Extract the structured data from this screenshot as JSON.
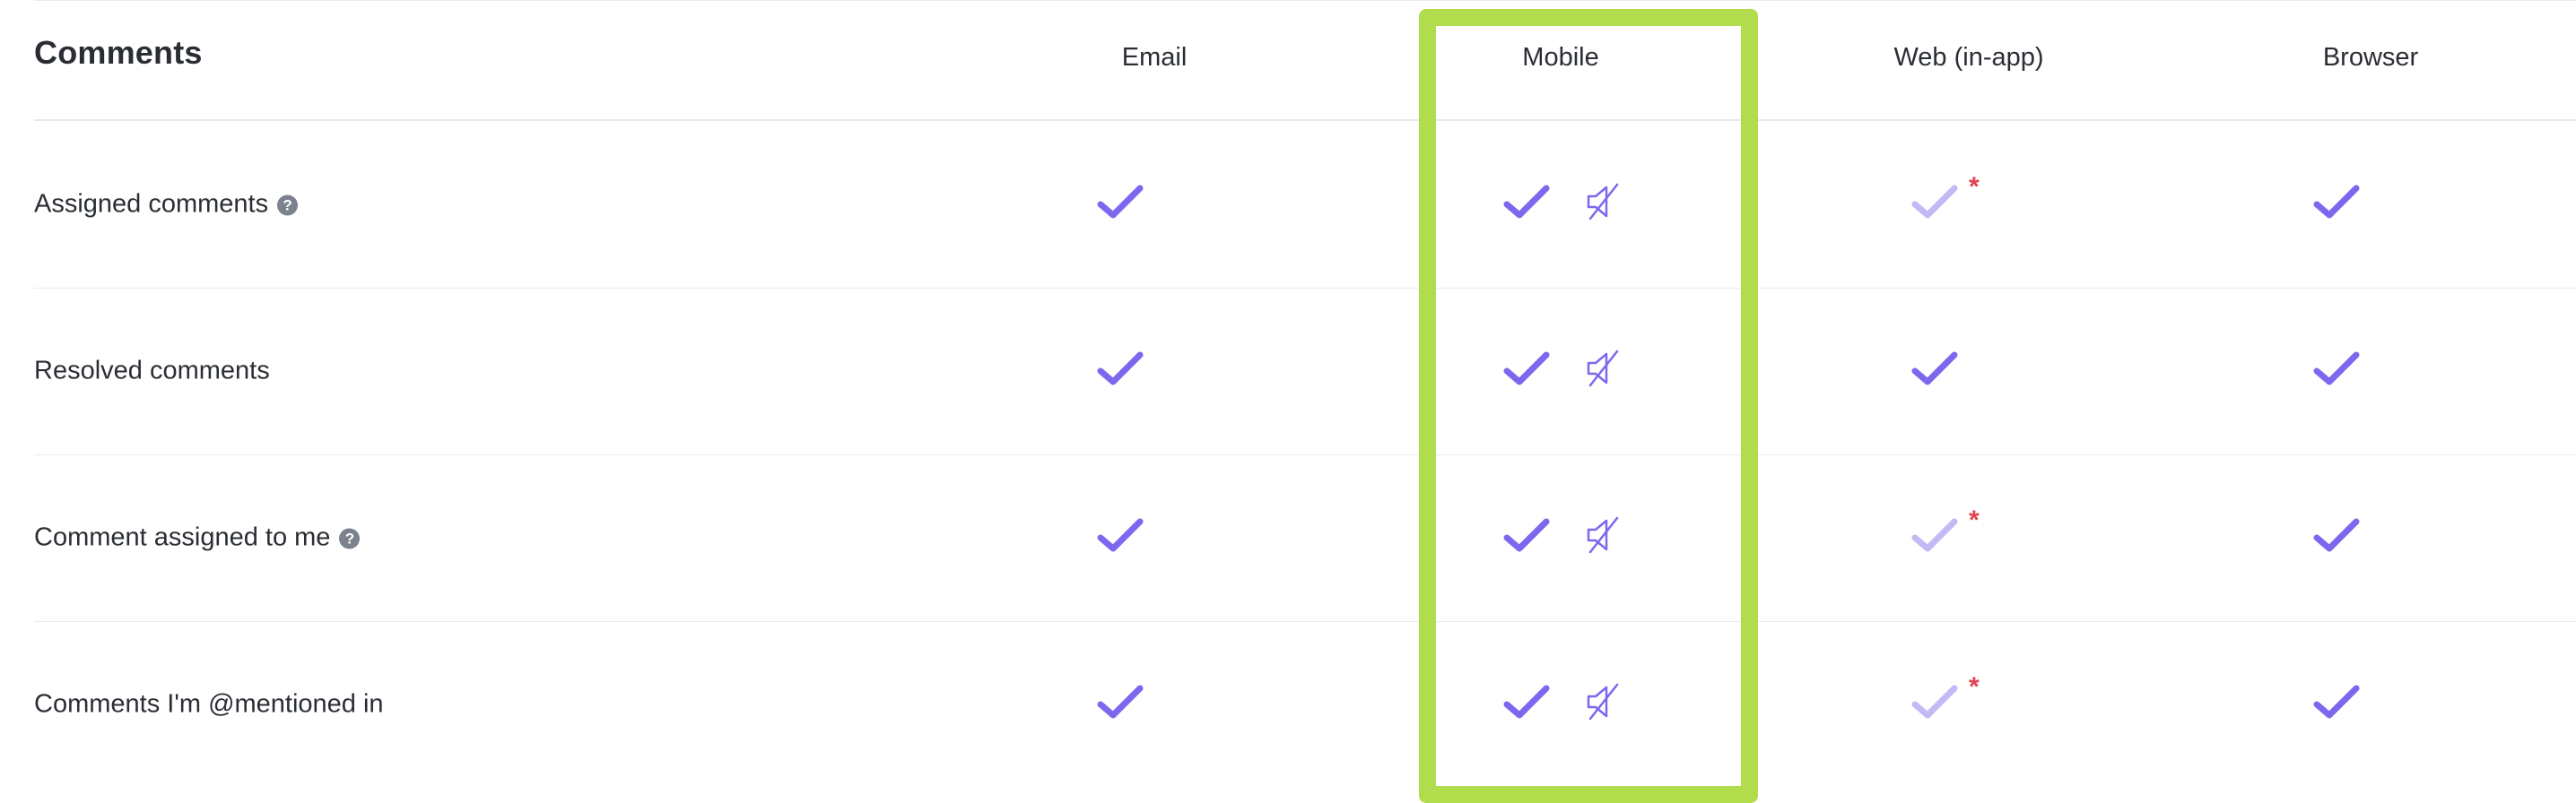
{
  "section": {
    "title": "Comments"
  },
  "columns": [
    {
      "key": "email",
      "label": "Email"
    },
    {
      "key": "mobile",
      "label": "Mobile"
    },
    {
      "key": "web",
      "label": "Web (in-app)"
    },
    {
      "key": "browser",
      "label": "Browser"
    }
  ],
  "rows": [
    {
      "label": "Assigned comments",
      "has_help": true,
      "email": "checked",
      "mobile": "checked",
      "mobile_sound": "muted",
      "web": "checked-disabled-required",
      "browser": "checked"
    },
    {
      "label": "Resolved comments",
      "has_help": false,
      "email": "checked",
      "mobile": "checked",
      "mobile_sound": "muted",
      "web": "checked",
      "browser": "checked"
    },
    {
      "label": "Comment assigned to me",
      "has_help": true,
      "email": "checked",
      "mobile": "checked",
      "mobile_sound": "muted",
      "web": "checked-disabled-required",
      "browser": "checked"
    },
    {
      "label": "Comments I'm @mentioned in",
      "has_help": false,
      "email": "checked",
      "mobile": "checked",
      "mobile_sound": "muted",
      "web": "checked-disabled-required",
      "browser": "checked"
    }
  ],
  "required_marker": "*",
  "help_glyph": "?",
  "icons": {
    "check": "check-icon",
    "mute": "sound-muted-icon",
    "help": "question-circle-icon"
  },
  "colors": {
    "check_active": "#7b68ee",
    "check_disabled": "#c2b9f5",
    "required_marker": "#e0424f",
    "highlight_border": "#b1dc4c"
  }
}
